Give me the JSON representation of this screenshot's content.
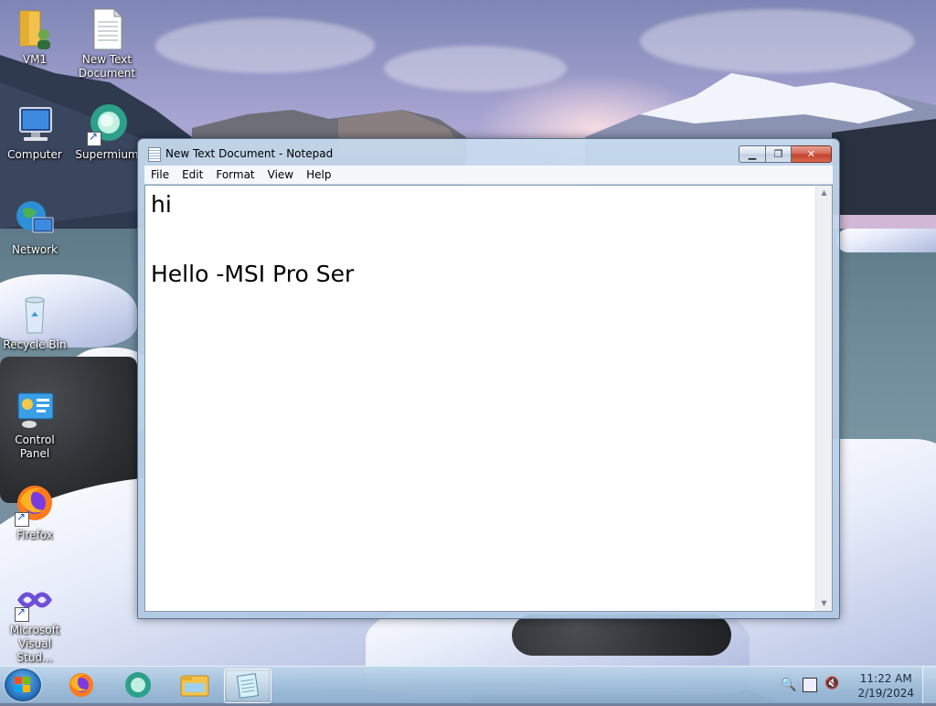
{
  "desktop": {
    "icons": [
      {
        "label": "VM1",
        "icon": "folder-user-icon"
      },
      {
        "label": "New Text\nDocument",
        "icon": "text-document-icon"
      },
      {
        "label": "Computer",
        "icon": "computer-icon"
      },
      {
        "label": "Supermium",
        "icon": "supermium-browser-icon"
      },
      {
        "label": "Network",
        "icon": "network-globe-icon"
      },
      {
        "label": "Recycle Bin",
        "icon": "recycle-bin-icon"
      },
      {
        "label": "Control Panel",
        "icon": "control-panel-icon"
      },
      {
        "label": "Firefox",
        "icon": "firefox-icon"
      },
      {
        "label": "Microsoft\nVisual Stud...",
        "icon": "visual-studio-icon"
      }
    ]
  },
  "notepad": {
    "title": "New Text Document - Notepad",
    "menu": [
      "File",
      "Edit",
      "Format",
      "View",
      "Help"
    ],
    "content_lines": [
      "hi",
      "",
      "Hello -MSI Pro Ser"
    ],
    "buttons": {
      "minimize": "minimize-icon",
      "maximize": "maximize-icon",
      "close": "close-icon"
    }
  },
  "taskbar": {
    "pinned": [
      "start-orb-icon",
      "firefox-icon",
      "supermium-browser-icon",
      "file-explorer-icon",
      "notepad-icon"
    ],
    "active": "notepad-icon",
    "tray_icons": [
      "search-icon",
      "network-icon",
      "volume-muted-icon"
    ],
    "time": "11:22 AM",
    "date": "2/19/2024"
  }
}
